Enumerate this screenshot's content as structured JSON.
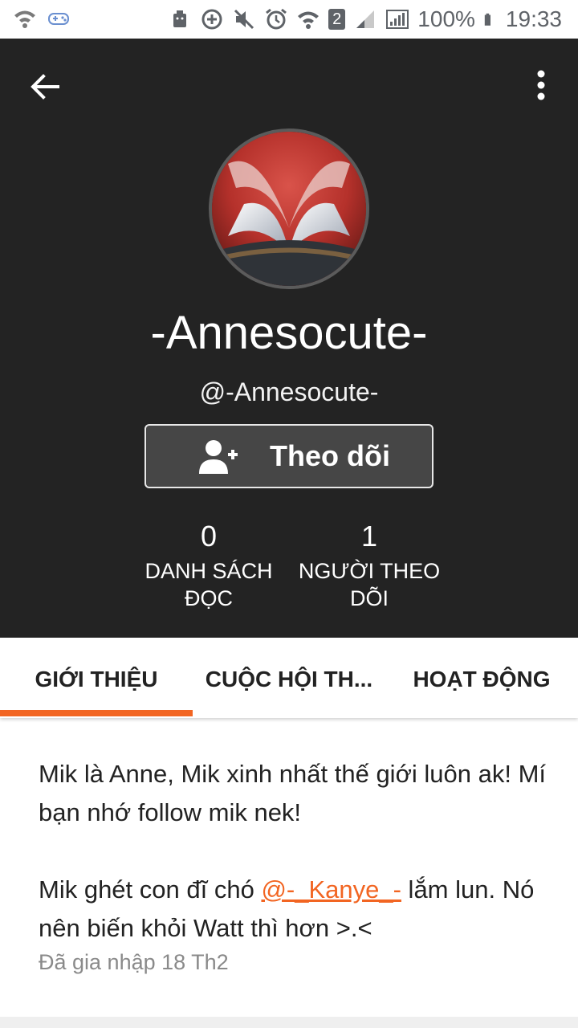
{
  "status_bar": {
    "battery_percent": "100%",
    "time": "19:33",
    "sim_badge": "2",
    "icons": [
      "wifi-icon",
      "game-controller-icon",
      "android-icon",
      "data-saver-icon",
      "mute-icon",
      "alarm-icon",
      "wifi-calling-icon",
      "signal-icon",
      "battery-icon"
    ]
  },
  "profile": {
    "display_name": "-Annesocute-",
    "username": "@-Annesocute-",
    "follow_label": "Theo dõi",
    "stats": [
      {
        "value": "0",
        "label_line1": "DANH SÁCH",
        "label_line2": "ĐỌC"
      },
      {
        "value": "1",
        "label_line1": "NGƯỜI THEO",
        "label_line2": "DÕI"
      }
    ]
  },
  "tabs": [
    {
      "label": "GIỚI THIỆU",
      "active": true
    },
    {
      "label": "CUỘC HỘI TH...",
      "active": false
    },
    {
      "label": "HOẠT ĐỘNG",
      "active": false
    }
  ],
  "about": {
    "paragraph1": "Mik là Anne, Mik xinh nhất thế giới luôn ak! Mí bạn nhớ follow mik nek!",
    "paragraph2_before": "Mik ghét con đĩ chó ",
    "mention": "@-_Kanye_-",
    "paragraph2_after": " lắm lun. Nó nên biến khỏi Watt thì hơn >.<",
    "joined": "Đã gia nhập 18 Th2"
  },
  "colors": {
    "accent": "#f26522",
    "header_bg": "#232323",
    "button_bg": "#464646"
  }
}
